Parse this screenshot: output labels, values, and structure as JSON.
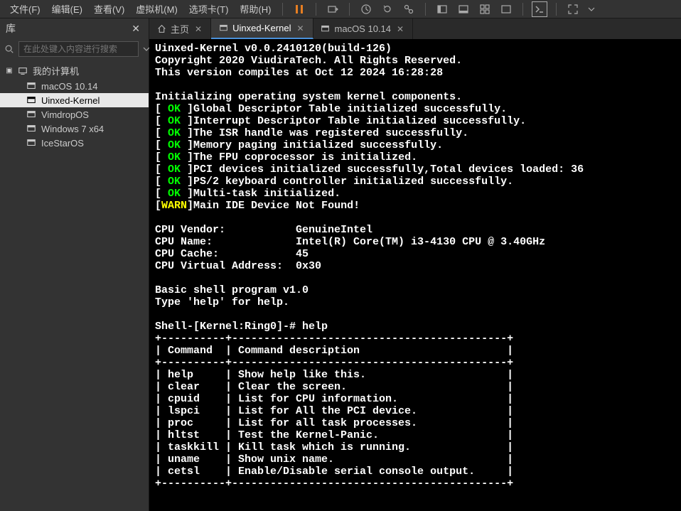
{
  "menu": {
    "file": "文件(F)",
    "edit": "编辑(E)",
    "view": "查看(V)",
    "vm": "虚拟机(M)",
    "tabs": "选项卡(T)",
    "help": "帮助(H)"
  },
  "sidebar": {
    "title": "库",
    "search_placeholder": "在此处键入内容进行搜索",
    "root": "我的计算机",
    "items": [
      "macOS 10.14",
      "Uinxed-Kernel",
      "VimdropOS",
      "Windows 7 x64",
      "IceStarOS"
    ],
    "selected_index": 1
  },
  "tabs": [
    {
      "label": "主页",
      "icon": "home",
      "active": false
    },
    {
      "label": "Uinxed-Kernel",
      "icon": "vm",
      "active": true
    },
    {
      "label": "macOS 10.14",
      "icon": "vm",
      "active": false
    }
  ],
  "terminal": {
    "header": [
      "Uinxed-Kernel v0.0.2410120(build-126)",
      "Copyright 2020 ViudiraTech. All Rights Reserved.",
      "This version compiles at Oct 12 2024 16:28:28"
    ],
    "init_line": "Initializing operating system kernel components.",
    "ok_lines": [
      "Global Descriptor Table initialized successfully.",
      "Interrupt Descriptor Table initialized successfully.",
      "The ISR handle was registered successfully.",
      "Memory paging initialized successfully.",
      "The FPU coprocessor is initialized.",
      "PCI devices initialized successfully,Total devices loaded: 36",
      "PS/2 keyboard controller initialized successfully.",
      "Multi-task initialized."
    ],
    "warn_line": "Main IDE Device Not Found!",
    "cpu": {
      "vendor_label": "CPU Vendor:",
      "vendor": "GenuineIntel",
      "name_label": "CPU Name:",
      "name": "Intel(R) Core(TM) i3-4130 CPU @ 3.40GHz",
      "cache_label": "CPU Cache:",
      "cache": "45",
      "vaddr_label": "CPU Virtual Address:",
      "vaddr": "0x30"
    },
    "shell_intro": [
      "Basic shell program v1.0",
      "Type 'help' for help."
    ],
    "prompt": "Shell-[Kernel:Ring0]-# help",
    "table": {
      "header_cmd": "Command",
      "header_desc": "Command description",
      "rows": [
        {
          "cmd": "help",
          "desc": "Show help like this."
        },
        {
          "cmd": "clear",
          "desc": "Clear the screen."
        },
        {
          "cmd": "cpuid",
          "desc": "List for CPU information."
        },
        {
          "cmd": "lspci",
          "desc": "List for All the PCI device."
        },
        {
          "cmd": "proc",
          "desc": "List for all task processes."
        },
        {
          "cmd": "hltst",
          "desc": "Test the Kernel-Panic."
        },
        {
          "cmd": "taskkill",
          "desc": "Kill task which is running."
        },
        {
          "cmd": "uname",
          "desc": "Show unix name."
        },
        {
          "cmd": "cetsl",
          "desc": "Enable/Disable serial console output."
        }
      ]
    }
  }
}
